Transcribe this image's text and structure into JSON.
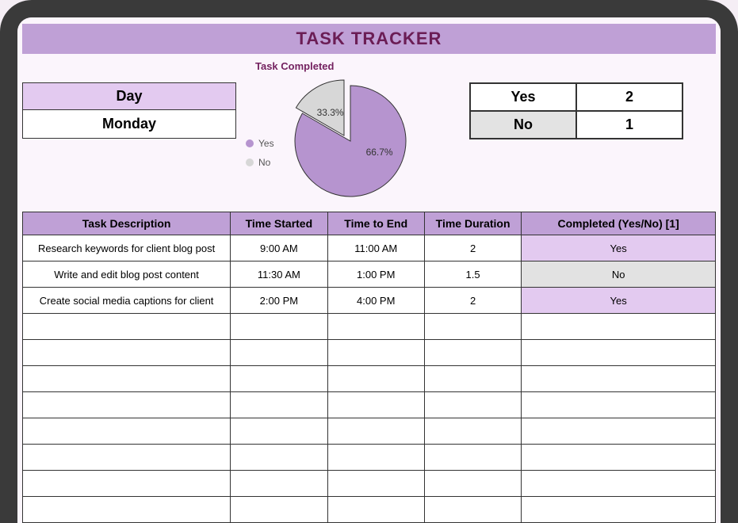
{
  "title": "TASK TRACKER",
  "day": {
    "header": "Day",
    "value": "Monday"
  },
  "chart_section_title": "Task Completed",
  "legend": {
    "yes": "Yes",
    "no": "No"
  },
  "counts": {
    "yes_label": "Yes",
    "yes_value": "2",
    "no_label": "No",
    "no_value": "1"
  },
  "chart_data": {
    "type": "pie",
    "title": "Task Completed",
    "categories": [
      "Yes",
      "No"
    ],
    "values": [
      66.7,
      33.3
    ],
    "labels": [
      "66.7%",
      "33.3%"
    ],
    "colors": {
      "Yes": "#b694cf",
      "No": "#d7d7d7"
    }
  },
  "table": {
    "headers": {
      "desc": "Task Description",
      "start": "Time Started",
      "end": "Time to End",
      "dur": "Time Duration",
      "comp": "Completed (Yes/No) [1]"
    },
    "rows": [
      {
        "desc": "Research keywords for client blog post",
        "start": "9:00 AM",
        "end": "11:00 AM",
        "dur": "2",
        "comp": "Yes"
      },
      {
        "desc": "Write and edit blog post content",
        "start": "11:30 AM",
        "end": "1:00 PM",
        "dur": "1.5",
        "comp": "No"
      },
      {
        "desc": "Create social media captions for client",
        "start": "2:00 PM",
        "end": "4:00 PM",
        "dur": "2",
        "comp": "Yes"
      }
    ],
    "empty_rows": 8
  }
}
